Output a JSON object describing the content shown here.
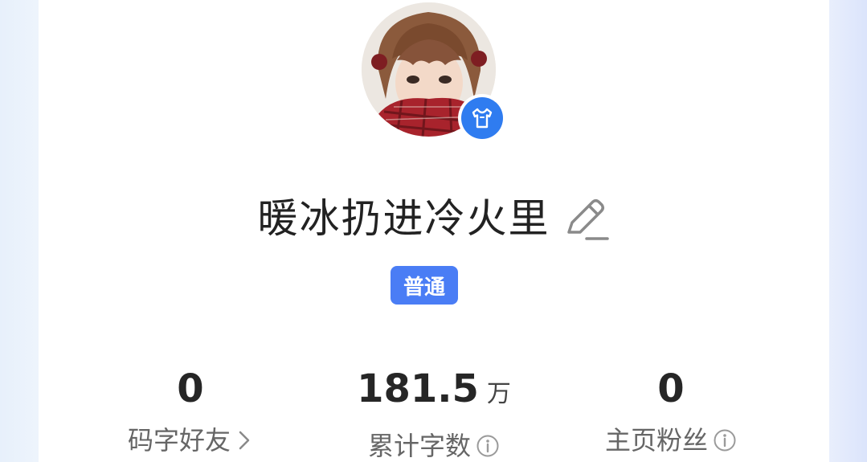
{
  "profile": {
    "username": "暖冰扔进冷火里",
    "level": "普通",
    "avatar_badge_icon": "tshirt-icon",
    "edit_icon": "pencil-icon",
    "accent_color": "#4a7df5"
  },
  "stats": [
    {
      "value": "0",
      "unit": "",
      "label": "码字好友",
      "icon": "chevron-right-icon"
    },
    {
      "value": "181.5",
      "unit": "万",
      "label": "累计字数",
      "icon": "info-icon"
    },
    {
      "value": "0",
      "unit": "",
      "label": "主页粉丝",
      "icon": "info-icon"
    }
  ]
}
